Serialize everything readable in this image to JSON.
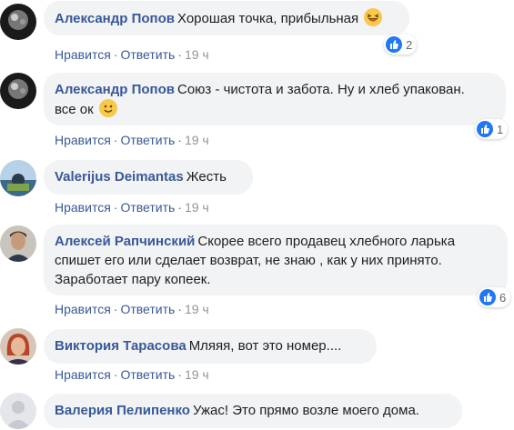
{
  "comments": [
    {
      "author": "Александр Попов",
      "text": "Хорошая точка, прибыльная",
      "emoji": "laughing-emoji",
      "reactions": "2",
      "actions": {
        "like": "Нравится",
        "reply": "Ответить",
        "time": "19 ч"
      }
    },
    {
      "author": "Александр Попов",
      "text_line1": "Союз - чистота и забота. Ну и хлеб упакован.",
      "text_line2": "все ок",
      "emoji": "smiling-emoji",
      "reactions": "1",
      "actions": {
        "like": "Нравится",
        "reply": "Ответить",
        "time": "19 ч"
      }
    },
    {
      "author": "Valerijus Deimantas",
      "text": "Жесть",
      "actions": {
        "like": "Нравится",
        "reply": "Ответить",
        "time": "19 ч"
      }
    },
    {
      "author": "Алексей Рапчинский",
      "text_line1": "Скорее всего продавец хлебного ларька",
      "text_line2": "спишет его или сделает возврат, не знаю , как у них принято.",
      "text_line3": "Заработает пару копеек.",
      "reactions": "6",
      "actions": {
        "like": "Нравится",
        "reply": "Ответить",
        "time": "19 ч"
      }
    },
    {
      "author": "Виктория Тарасова",
      "text": "Мляяя, вот это номер....",
      "actions": {
        "like": "Нравится",
        "reply": "Ответить",
        "time": "19 ч"
      }
    },
    {
      "author": "Валерия Пелипенко",
      "text": "Ужас! Это прямо возле моего дома."
    }
  ],
  "separator": "·",
  "colors": {
    "link": "#385898",
    "bubble": "#f2f3f5",
    "like_blue": "#2078f4",
    "meta": "#606770"
  }
}
